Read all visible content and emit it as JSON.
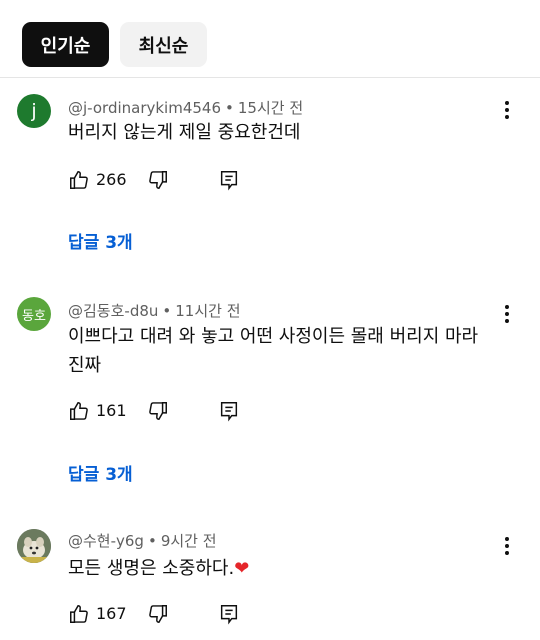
{
  "sort_tabs": [
    {
      "label": "인기순",
      "active": true
    },
    {
      "label": "최신순",
      "active": false
    }
  ],
  "comments": [
    {
      "avatar_letter": "j",
      "avatar_color": "#1e7a2e",
      "author": "@j-ordinarykim4546",
      "time": "15시간 전",
      "text": "버리지 않는게 제일 중요한건데",
      "likes": "266",
      "replies_label": "답글 3개"
    },
    {
      "avatar_letter": "동호",
      "avatar_color": "#5aa63c",
      "author": "@김동호-d8u",
      "time": "11시간 전",
      "text": "이쁘다고 대려 와 놓고 어떤 사정이든 몰래 버리지 마라 진짜",
      "likes": "161",
      "replies_label": "답글 3개"
    },
    {
      "avatar_letter": "",
      "avatar_color": "#5b6a5a",
      "author": "@수현-y6g",
      "time": "9시간 전",
      "text": "모든 생명은 소중하다.",
      "text_emoji": "❤",
      "likes": "167"
    }
  ],
  "icons": {
    "like": "thumb-up-icon",
    "dislike": "thumb-down-icon",
    "reply": "comment-reply-icon",
    "more": "more-vertical-icon"
  },
  "colors": {
    "link": "#065fd4",
    "meta": "#606060",
    "chip_active": "#0f0f0f",
    "chip_inactive": "#f2f2f2",
    "heart": "#e5262a"
  }
}
